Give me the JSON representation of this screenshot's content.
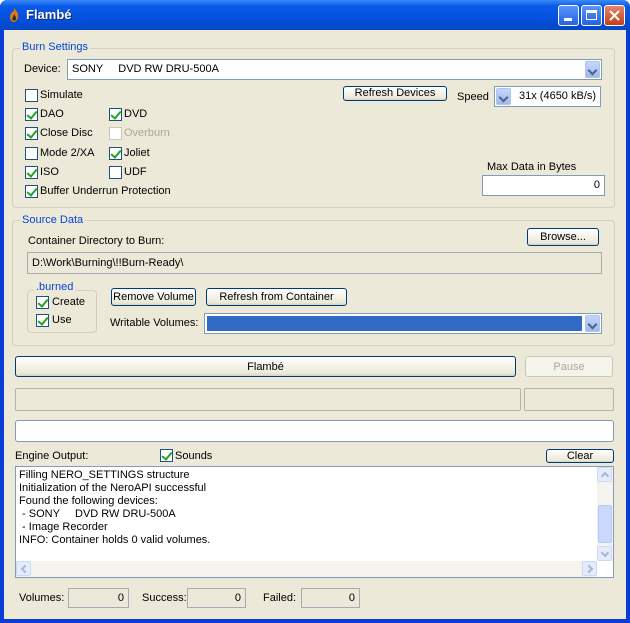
{
  "window": {
    "title": "Flambé"
  },
  "burn_settings": {
    "group_label": "Burn Settings",
    "device_label": "Device:",
    "device_value": "SONY     DVD RW DRU-500A",
    "refresh_devices": "Refresh Devices",
    "speed_label": "Speed",
    "speed_value": "31x (4650 kB/s)",
    "max_data_label": "Max Data in Bytes",
    "max_data_value": "0",
    "options": {
      "simulate": "Simulate",
      "dao": "DAO",
      "dvd": "DVD",
      "close_disc": "Close Disc",
      "overburn": "Overburn",
      "mode2xa": "Mode 2/XA",
      "joliet": "Joliet",
      "iso": "ISO",
      "udf": "UDF",
      "buffer_underrun": "Buffer Underrun Protection"
    }
  },
  "source_data": {
    "group_label": "Source Data",
    "container_label": "Container Directory to Burn:",
    "browse": "Browse...",
    "container_path": "D:\\Work\\Burning\\!!Burn-Ready\\",
    "burned_group": ".burned",
    "create": "Create",
    "use": "Use",
    "remove_volume": "Remove Volume",
    "refresh_container": "Refresh from Container",
    "writable_label": "Writable Volumes:",
    "writable_value": ""
  },
  "actions": {
    "flambe": "Flambé",
    "pause": "Pause"
  },
  "engine": {
    "label": "Engine Output:",
    "sounds": "Sounds",
    "clear": "Clear",
    "log": [
      "Filling NERO_SETTINGS structure",
      "Initialization of the NeroAPI successful",
      "Found the following devices:",
      " - SONY     DVD RW DRU-500A",
      " - Image Recorder",
      "INFO: Container holds 0 valid volumes."
    ]
  },
  "stats": {
    "volumes_label": "Volumes:",
    "volumes_value": "0",
    "success_label": "Success:",
    "success_value": "0",
    "failed_label": "Failed:",
    "failed_value": "0"
  },
  "colors": {
    "accent": "#316ac5",
    "titlebar": "#0550dc",
    "group_label": "#0046d5"
  }
}
